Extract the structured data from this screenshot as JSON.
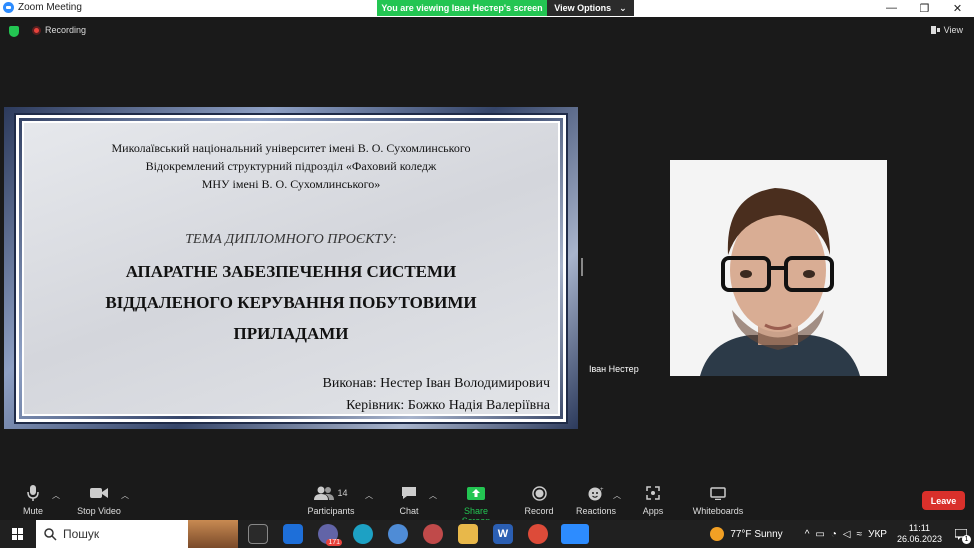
{
  "window": {
    "title": "Zoom Meeting",
    "minimize": "—",
    "maximize": "❐",
    "close": "✕"
  },
  "banner": {
    "text": "You are viewing Іван Нестер's screen",
    "view_options": "View Options",
    "chevron": "⌄"
  },
  "status": {
    "recording": "Recording",
    "view": "View"
  },
  "slide": {
    "line1": "Миколаївський національний університет імені В. О. Сухомлинського",
    "line2": "Відокремлений структурний підрозділ «Фаховий коледж",
    "line3": "МНУ імені В. О. Сухомлинського»",
    "topic": "ТЕМА ДИПЛОМНОГО ПРОЄКТУ:",
    "title1": "АПАРАТНЕ ЗАБЕЗПЕЧЕННЯ СИСТЕМИ",
    "title2": "ВІДДАЛЕНОГО КЕРУВАННЯ ПОБУТОВИМИ",
    "title3": "ПРИЛАДАМИ",
    "author": "Виконав: Нестер Іван Володимирович",
    "supervisor": "Керівник: Божко Надія Валеріївна"
  },
  "participant": {
    "name": "Іван Нестер"
  },
  "toolbar": {
    "mute": "Mute",
    "stop_video": "Stop Video",
    "participants": "Participants",
    "participants_count": "14",
    "chat": "Chat",
    "share_screen": "Share Screen",
    "record": "Record",
    "reactions": "Reactions",
    "apps": "Apps",
    "whiteboards": "Whiteboards",
    "leave": "Leave"
  },
  "taskbar": {
    "search_placeholder": "Пошук",
    "weather": "77°F  Sunny",
    "lang": "УКР",
    "time": "11:11",
    "date": "26.06.2023",
    "notifications": "1",
    "teams_badge": "171"
  },
  "colors": {
    "share_green": "#23c552",
    "leave_red": "#d9302b",
    "zoom_blue": "#2d8cff"
  }
}
